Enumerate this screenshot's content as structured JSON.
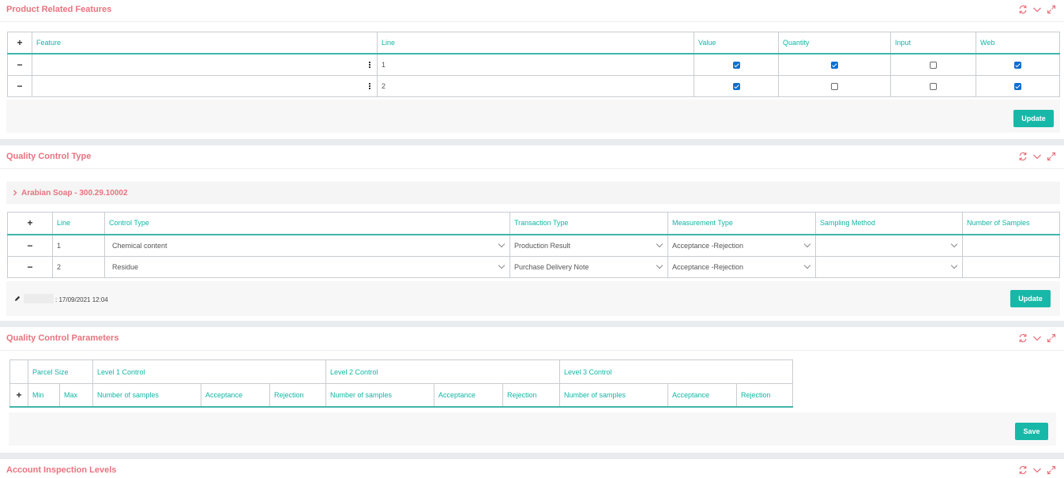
{
  "panels": {
    "product_features": {
      "title": "Product Related Features",
      "columns": [
        "Feature",
        "Line",
        "Value",
        "Quantity",
        "Input",
        "Web"
      ],
      "rows": [
        {
          "line": "1",
          "value": true,
          "quantity": true,
          "input": false,
          "web": true
        },
        {
          "line": "2",
          "value": true,
          "quantity": false,
          "input": false,
          "web": true
        }
      ],
      "button": "Update"
    },
    "qc_type": {
      "title": "Quality Control Type",
      "group_label": "Arabian Soap - 300.29.10002",
      "columns": [
        "Line",
        "Control Type",
        "Transaction Type",
        "Measurement Type",
        "Sampling Method",
        "Number of Samples"
      ],
      "rows": [
        {
          "line": "1",
          "control_type": "Chemical content",
          "transaction_type": "Production Result",
          "measurement_type": "Acceptance -Rejection",
          "sampling_method": "",
          "samples": ""
        },
        {
          "line": "2",
          "control_type": "Residue",
          "transaction_type": "Purchase Delivery Note",
          "measurement_type": "Acceptance -Rejection",
          "sampling_method": "",
          "samples": ""
        }
      ],
      "edit_info": ": 17/09/2021 12:04",
      "button": "Update"
    },
    "qc_params": {
      "title": "Quality Control Parameters",
      "group_headers": [
        "Parcel Size",
        "Level 1 Control",
        "Level 2 Control",
        "Level 3 Control"
      ],
      "columns": [
        "Min",
        "Max",
        "Number of samples",
        "Acceptance",
        "Rejection",
        "Number of samples",
        "Acceptance",
        "Rejection",
        "Number of samples",
        "Acceptance",
        "Rejection"
      ],
      "button": "Save"
    },
    "inspection_levels": {
      "title": "Account Inspection Levels"
    }
  },
  "colors": {
    "title": "#e8737f",
    "accent": "#18b8a8",
    "header_text": "#12b6a5",
    "checkbox": "#0a6fd1"
  }
}
